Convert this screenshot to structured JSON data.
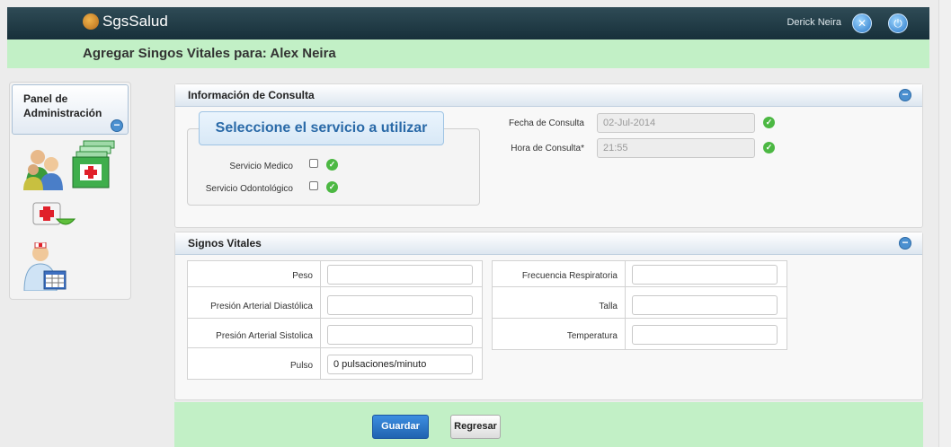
{
  "header": {
    "app_name": "SgsSalud",
    "user_name": "Derick Neira"
  },
  "page": {
    "title": "Agregar Singos Vitales para: Alex Neira"
  },
  "sidebar": {
    "title": "Panel de Administración",
    "collapse_glyph": "−"
  },
  "consulta": {
    "panel_title": "Información de Consulta",
    "service_legend": "Seleccione el servicio a utilizar",
    "services": [
      {
        "label": "Servicio Medico",
        "checked": false
      },
      {
        "label": "Servicio Odontológico",
        "checked": false
      }
    ],
    "fecha_label": "Fecha de Consulta",
    "fecha_value": "02-Jul-2014",
    "hora_label": "Hora de Consulta*",
    "hora_value": "21:55"
  },
  "vitales": {
    "panel_title": "Signos Vitales",
    "left_fields": [
      {
        "label": "Peso",
        "value": ""
      },
      {
        "label": "Presión Arterial Diastólica",
        "value": ""
      },
      {
        "label": "Presión Arterial Sistolica",
        "value": ""
      },
      {
        "label": "Pulso",
        "value": "0  pulsaciones/minuto"
      }
    ],
    "right_fields": [
      {
        "label": "Frecuencia Respiratoria",
        "value": ""
      },
      {
        "label": "Talla",
        "value": ""
      },
      {
        "label": "Temperatura",
        "value": ""
      }
    ]
  },
  "actions": {
    "save_label": "Guardar",
    "back_label": "Regresar"
  },
  "colors": {
    "accent": "#2a78c8",
    "ok_green": "#4cb843",
    "title_band": "#c2f0c6",
    "topbar": "#1f3a45"
  }
}
